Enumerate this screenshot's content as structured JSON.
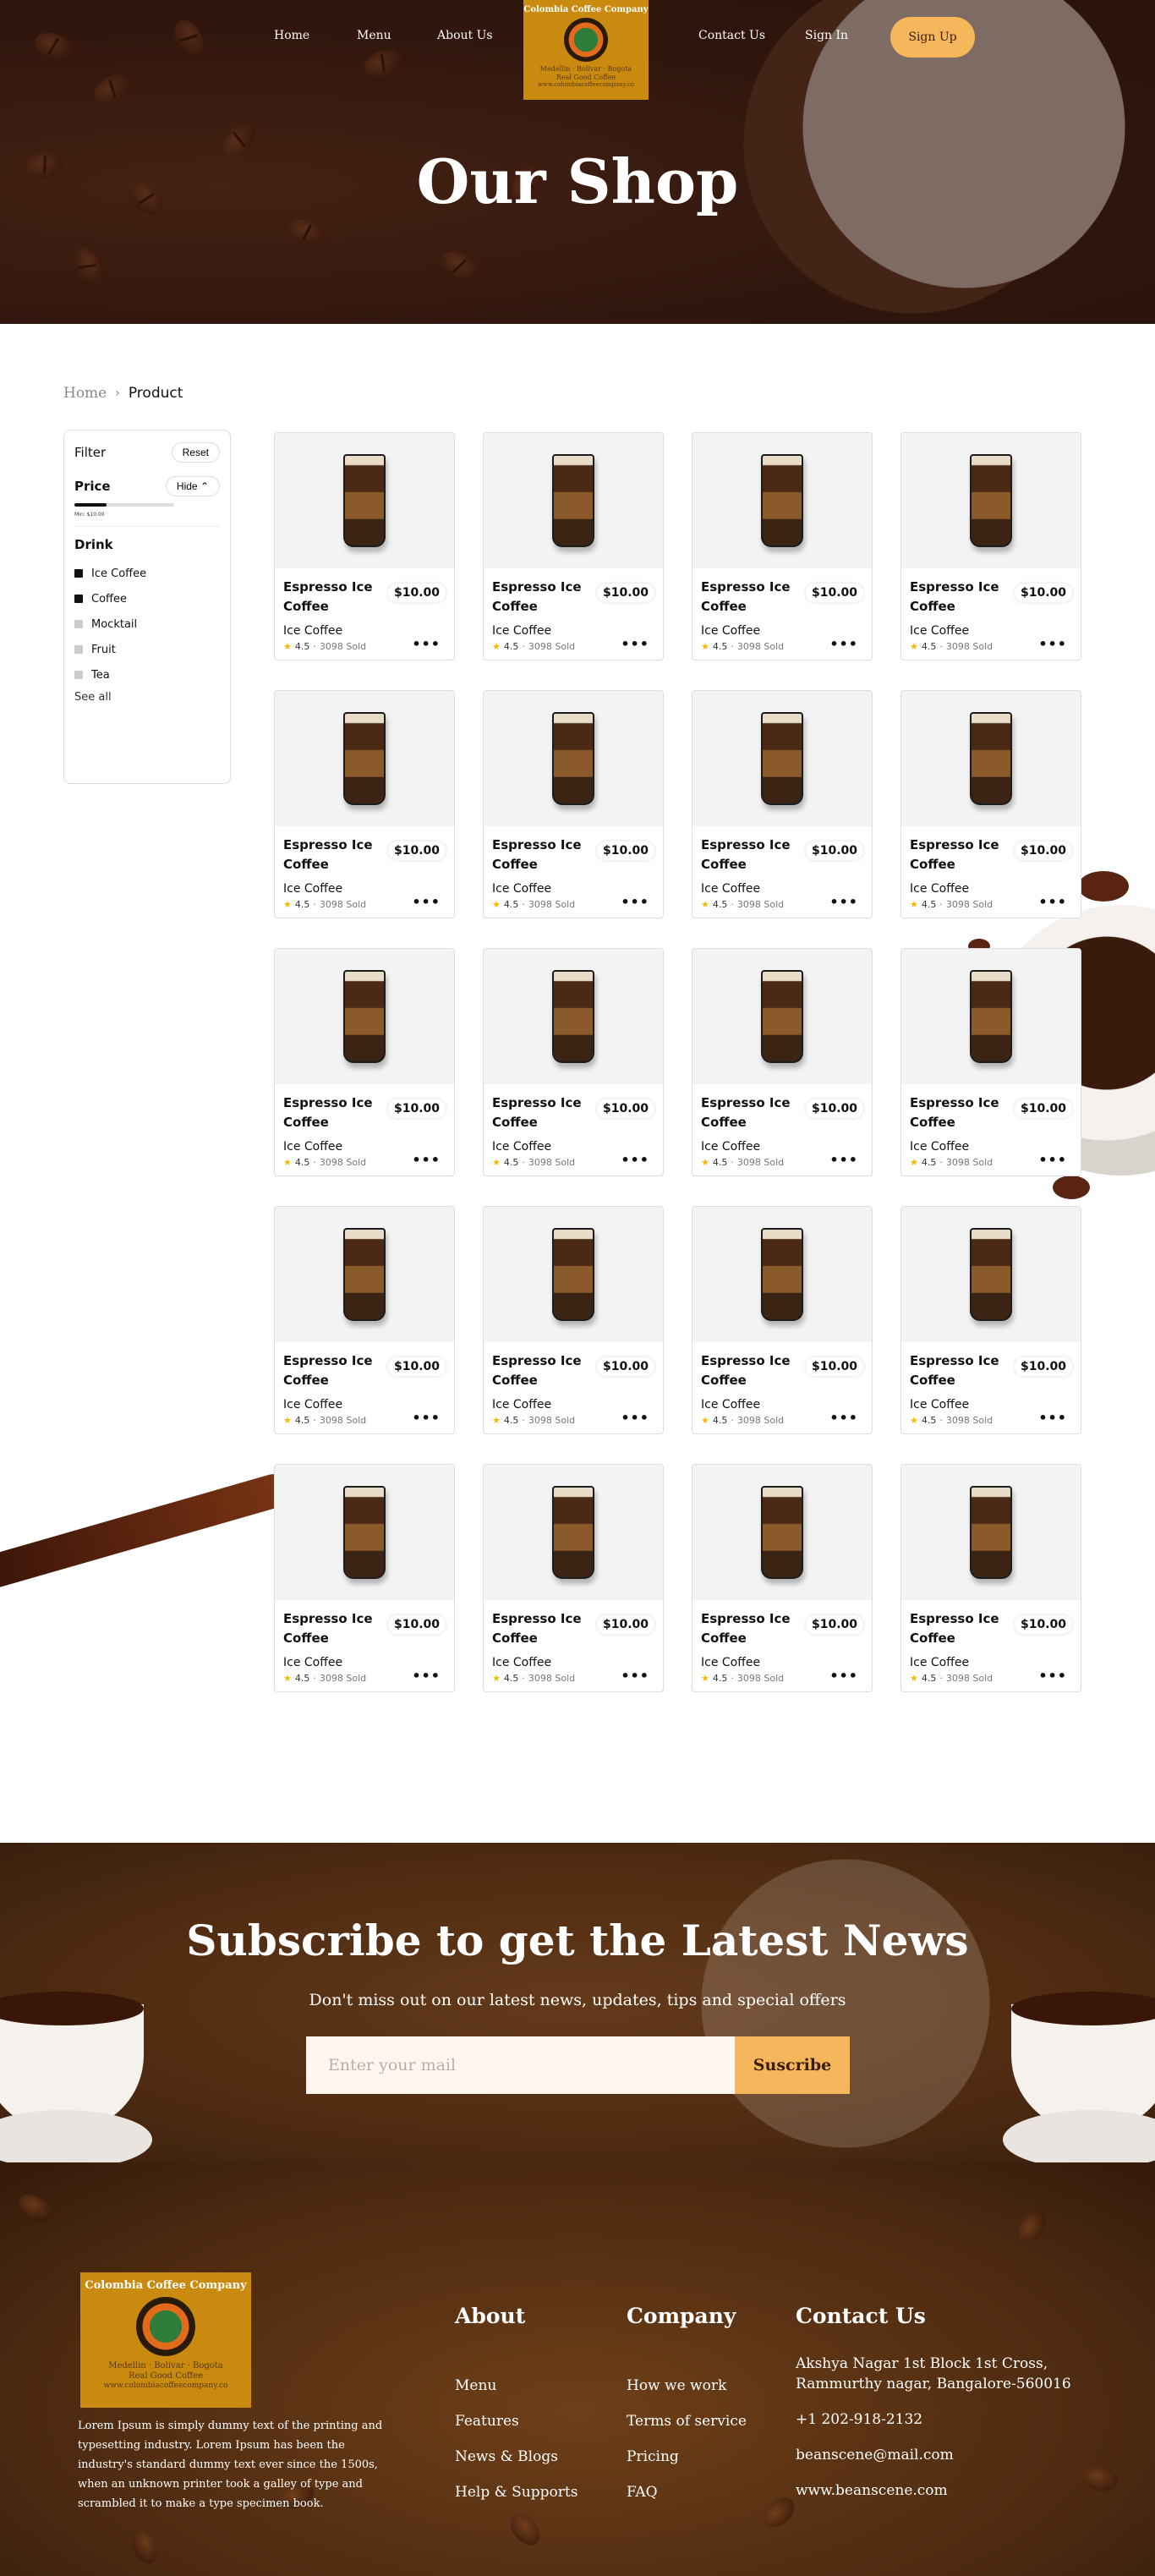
{
  "nav": {
    "home": "Home",
    "menu": "Menu",
    "about": "About Us",
    "contact": "Contact Us",
    "signin": "Sign In",
    "signup": "Sign Up"
  },
  "logo": {
    "brand": "Colombia Coffee Company",
    "tagline1": "Medellin · Bolivar · Bogota",
    "tagline2": "Real Good Coffee",
    "url": "www.colombiacoffeecompany.co"
  },
  "hero": {
    "title": "Our Shop"
  },
  "breadcrumb": {
    "home": "Home",
    "current": "Product"
  },
  "filter": {
    "title": "Filter",
    "reset": "Reset",
    "price_label": "Price",
    "hide": "Hide",
    "min_label": "Min: $10.00",
    "slider_fraction": 0.32,
    "drink_title": "Drink",
    "options": [
      {
        "label": "Ice Coffee",
        "checked": true
      },
      {
        "label": "Coffee",
        "checked": true
      },
      {
        "label": "Mocktail",
        "checked": false
      },
      {
        "label": "Fruit",
        "checked": false
      },
      {
        "label": "Tea",
        "checked": false
      }
    ],
    "see_all": "See all"
  },
  "products": [
    {
      "name": "Espresso Ice Coffee",
      "price": "$10.00",
      "category": "Ice Coffee",
      "rating": "4.5",
      "sold": "3098 Sold"
    },
    {
      "name": "Espresso Ice Coffee",
      "price": "$10.00",
      "category": "Ice Coffee",
      "rating": "4.5",
      "sold": "3098 Sold"
    },
    {
      "name": "Espresso Ice Coffee",
      "price": "$10.00",
      "category": "Ice Coffee",
      "rating": "4.5",
      "sold": "3098 Sold"
    },
    {
      "name": "Espresso Ice Coffee",
      "price": "$10.00",
      "category": "Ice Coffee",
      "rating": "4.5",
      "sold": "3098 Sold"
    },
    {
      "name": "Espresso Ice Coffee",
      "price": "$10.00",
      "category": "Ice Coffee",
      "rating": "4.5",
      "sold": "3098 Sold"
    },
    {
      "name": "Espresso Ice Coffee",
      "price": "$10.00",
      "category": "Ice Coffee",
      "rating": "4.5",
      "sold": "3098 Sold"
    },
    {
      "name": "Espresso Ice Coffee",
      "price": "$10.00",
      "category": "Ice Coffee",
      "rating": "4.5",
      "sold": "3098 Sold"
    },
    {
      "name": "Espresso Ice Coffee",
      "price": "$10.00",
      "category": "Ice Coffee",
      "rating": "4.5",
      "sold": "3098 Sold"
    },
    {
      "name": "Espresso Ice Coffee",
      "price": "$10.00",
      "category": "Ice Coffee",
      "rating": "4.5",
      "sold": "3098 Sold"
    },
    {
      "name": "Espresso Ice Coffee",
      "price": "$10.00",
      "category": "Ice Coffee",
      "rating": "4.5",
      "sold": "3098 Sold"
    },
    {
      "name": "Espresso Ice Coffee",
      "price": "$10.00",
      "category": "Ice Coffee",
      "rating": "4.5",
      "sold": "3098 Sold"
    },
    {
      "name": "Espresso Ice Coffee",
      "price": "$10.00",
      "category": "Ice Coffee",
      "rating": "4.5",
      "sold": "3098 Sold"
    },
    {
      "name": "Espresso Ice Coffee",
      "price": "$10.00",
      "category": "Ice Coffee",
      "rating": "4.5",
      "sold": "3098 Sold"
    },
    {
      "name": "Espresso Ice Coffee",
      "price": "$10.00",
      "category": "Ice Coffee",
      "rating": "4.5",
      "sold": "3098 Sold"
    },
    {
      "name": "Espresso Ice Coffee",
      "price": "$10.00",
      "category": "Ice Coffee",
      "rating": "4.5",
      "sold": "3098 Sold"
    },
    {
      "name": "Espresso Ice Coffee",
      "price": "$10.00",
      "category": "Ice Coffee",
      "rating": "4.5",
      "sold": "3098 Sold"
    },
    {
      "name": "Espresso Ice Coffee",
      "price": "$10.00",
      "category": "Ice Coffee",
      "rating": "4.5",
      "sold": "3098 Sold"
    },
    {
      "name": "Espresso Ice Coffee",
      "price": "$10.00",
      "category": "Ice Coffee",
      "rating": "4.5",
      "sold": "3098 Sold"
    },
    {
      "name": "Espresso Ice Coffee",
      "price": "$10.00",
      "category": "Ice Coffee",
      "rating": "4.5",
      "sold": "3098 Sold"
    },
    {
      "name": "Espresso Ice Coffee",
      "price": "$10.00",
      "category": "Ice Coffee",
      "rating": "4.5",
      "sold": "3098 Sold"
    }
  ],
  "subscribe": {
    "title": "Subscribe to get the Latest News",
    "subtitle": "Don't miss out on our latest news, updates, tips and special offers",
    "placeholder": "Enter your mail",
    "button": "Suscribe"
  },
  "footer": {
    "about_text": "Lorem Ipsum is simply dummy text of the printing and typesetting industry. Lorem Ipsum has been the industry's standard dummy text ever since the 1500s, when an unknown printer took a galley of type and scrambled it to make a type specimen book.",
    "about_title": "About",
    "about_links": [
      "Menu",
      "Features",
      "News & Blogs",
      "Help & Supports"
    ],
    "company_title": "Company",
    "company_links": [
      "How we work",
      "Terms of service",
      "Pricing",
      "FAQ"
    ],
    "contact_title": "Contact Us",
    "address": "Akshya Nagar 1st Block 1st Cross, Rammurthy nagar, Bangalore-560016",
    "phone": "+1 202-918-2132",
    "email": "beanscene@mail.com",
    "website": "www.beanscene.com"
  },
  "colors": {
    "accent": "#f6b75c",
    "brand_gold": "#c98a0f",
    "coffee_dark": "#3a1c10"
  }
}
